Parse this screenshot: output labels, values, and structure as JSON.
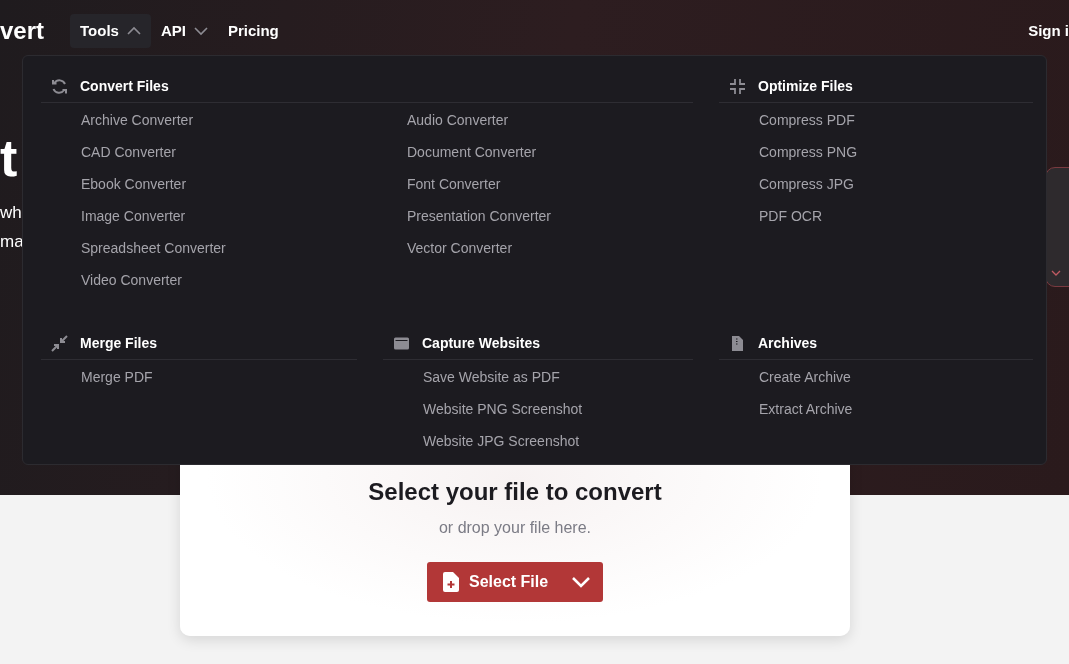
{
  "navbar": {
    "logo": "vert",
    "items": [
      {
        "label": "Tools",
        "kind": "dropdown",
        "expanded": true
      },
      {
        "label": "API",
        "kind": "dropdown",
        "expanded": false
      },
      {
        "label": "Pricing",
        "kind": "link"
      }
    ],
    "sign_in": "Sign i"
  },
  "hero": {
    "title": "t",
    "lines": [
      "wh",
      "ma"
    ]
  },
  "tools_menu": {
    "sections": [
      {
        "title": "Convert Files",
        "items": [
          "Archive Converter",
          "Audio Converter",
          "CAD Converter",
          "Document Converter",
          "Ebook Converter",
          "Font Converter",
          "Image Converter",
          "Presentation Converter",
          "Spreadsheet Converter",
          "Vector Converter",
          "Video Converter"
        ]
      },
      {
        "title": "Optimize Files",
        "items": [
          "Compress PDF",
          "Compress PNG",
          "Compress JPG",
          "PDF OCR"
        ]
      },
      {
        "title": "Merge Files",
        "items": [
          "Merge PDF"
        ]
      },
      {
        "title": "Capture Websites",
        "items": [
          "Save Website as PDF",
          "Website PNG Screenshot",
          "Website JPG Screenshot"
        ]
      },
      {
        "title": "Archives",
        "items": [
          "Create Archive",
          "Extract Archive"
        ]
      }
    ]
  },
  "upload": {
    "title": "Select your file to convert",
    "subtitle": "or drop your file here.",
    "button": "Select File"
  }
}
